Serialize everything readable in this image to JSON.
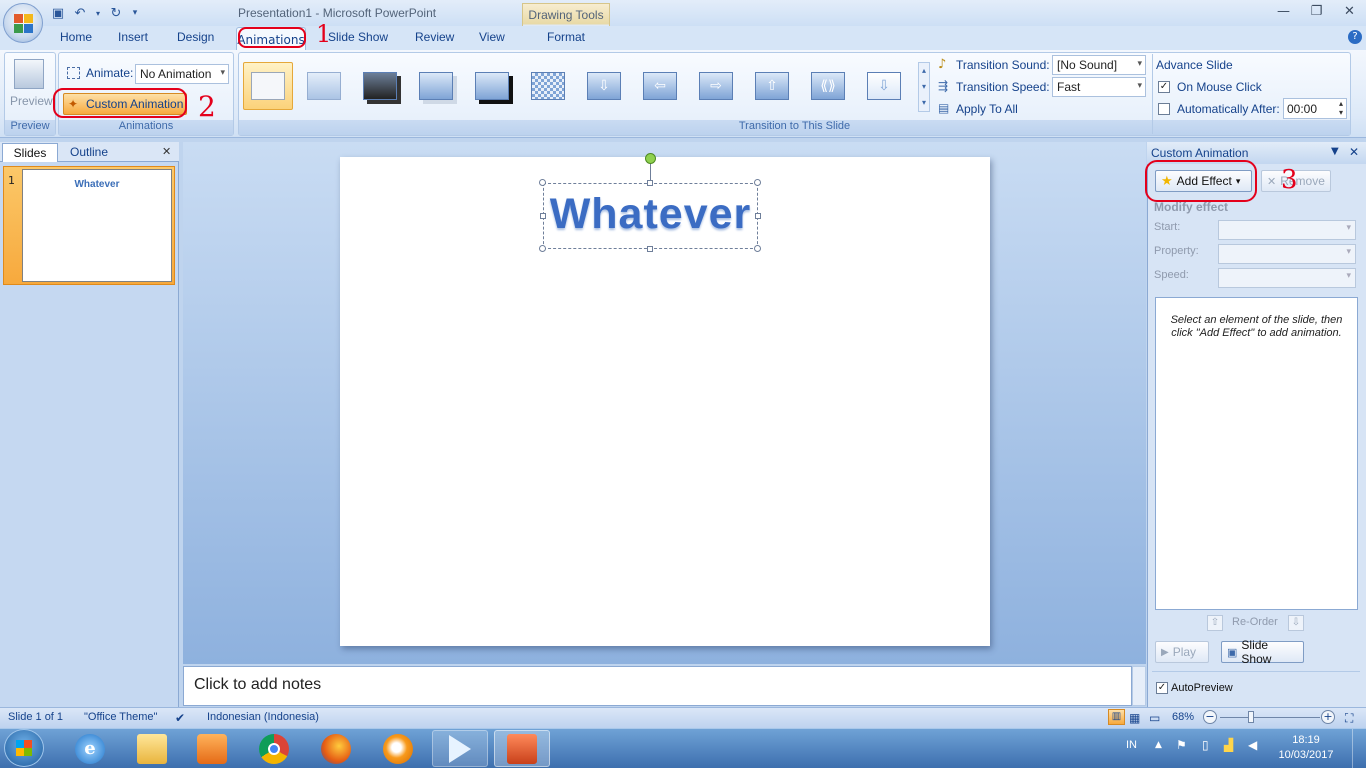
{
  "window": {
    "title": "Presentation1 - Microsoft PowerPoint",
    "contextual_tab_group": "Drawing Tools"
  },
  "tabs": [
    "Home",
    "Insert",
    "Design",
    "Animations",
    "Slide Show",
    "Review",
    "View",
    "Format"
  ],
  "active_tab": "Animations",
  "ribbon": {
    "preview_group": {
      "button": "Preview",
      "label": "Preview"
    },
    "animations_group": {
      "animate_label": "Animate:",
      "animate_value": "No Animation",
      "custom_animation": "Custom Animation",
      "label": "Animations"
    },
    "transition_group": {
      "label": "Transition to This Slide",
      "sound_label": "Transition Sound:",
      "sound_value": "[No Sound]",
      "speed_label": "Transition Speed:",
      "speed_value": "Fast",
      "apply_all": "Apply To All"
    },
    "advance_group": {
      "title": "Advance Slide",
      "on_mouse_click": "On Mouse Click",
      "on_mouse_click_checked": true,
      "auto_after": "Automatically After:",
      "auto_after_checked": false,
      "auto_after_value": "00:00"
    }
  },
  "left_pane": {
    "tab_slides": "Slides",
    "tab_outline": "Outline",
    "slide_number": "1",
    "slide_thumb_title": "Whatever"
  },
  "slide": {
    "title": "Whatever"
  },
  "notes": {
    "placeholder": "Click to add notes"
  },
  "task_pane": {
    "title": "Custom Animation",
    "add_effect": "Add Effect",
    "remove": "Remove",
    "modify_effect": "Modify effect",
    "start_label": "Start:",
    "property_label": "Property:",
    "speed_label": "Speed:",
    "hint": "Select an element of the slide, then click \"Add Effect\" to add animation.",
    "reorder": "Re-Order",
    "play": "Play",
    "slide_show": "Slide Show",
    "autopreview": "AutoPreview",
    "autopreview_checked": true
  },
  "status_bar": {
    "slide_info": "Slide 1 of 1",
    "theme": "\"Office Theme\"",
    "language": "Indonesian (Indonesia)",
    "zoom": "68%"
  },
  "taskbar": {
    "language": "IN",
    "time": "18:19",
    "date": "10/03/2017",
    "apps": [
      "internet-explorer",
      "file-explorer",
      "media-player",
      "chrome",
      "firefox",
      "media-app",
      "video-player",
      "powerpoint"
    ]
  },
  "annotations": [
    "1",
    "2",
    "3"
  ],
  "colors": {
    "accent": "#15428b",
    "annotation_red": "#e4001b",
    "active_group_button": "#f7a93d"
  }
}
